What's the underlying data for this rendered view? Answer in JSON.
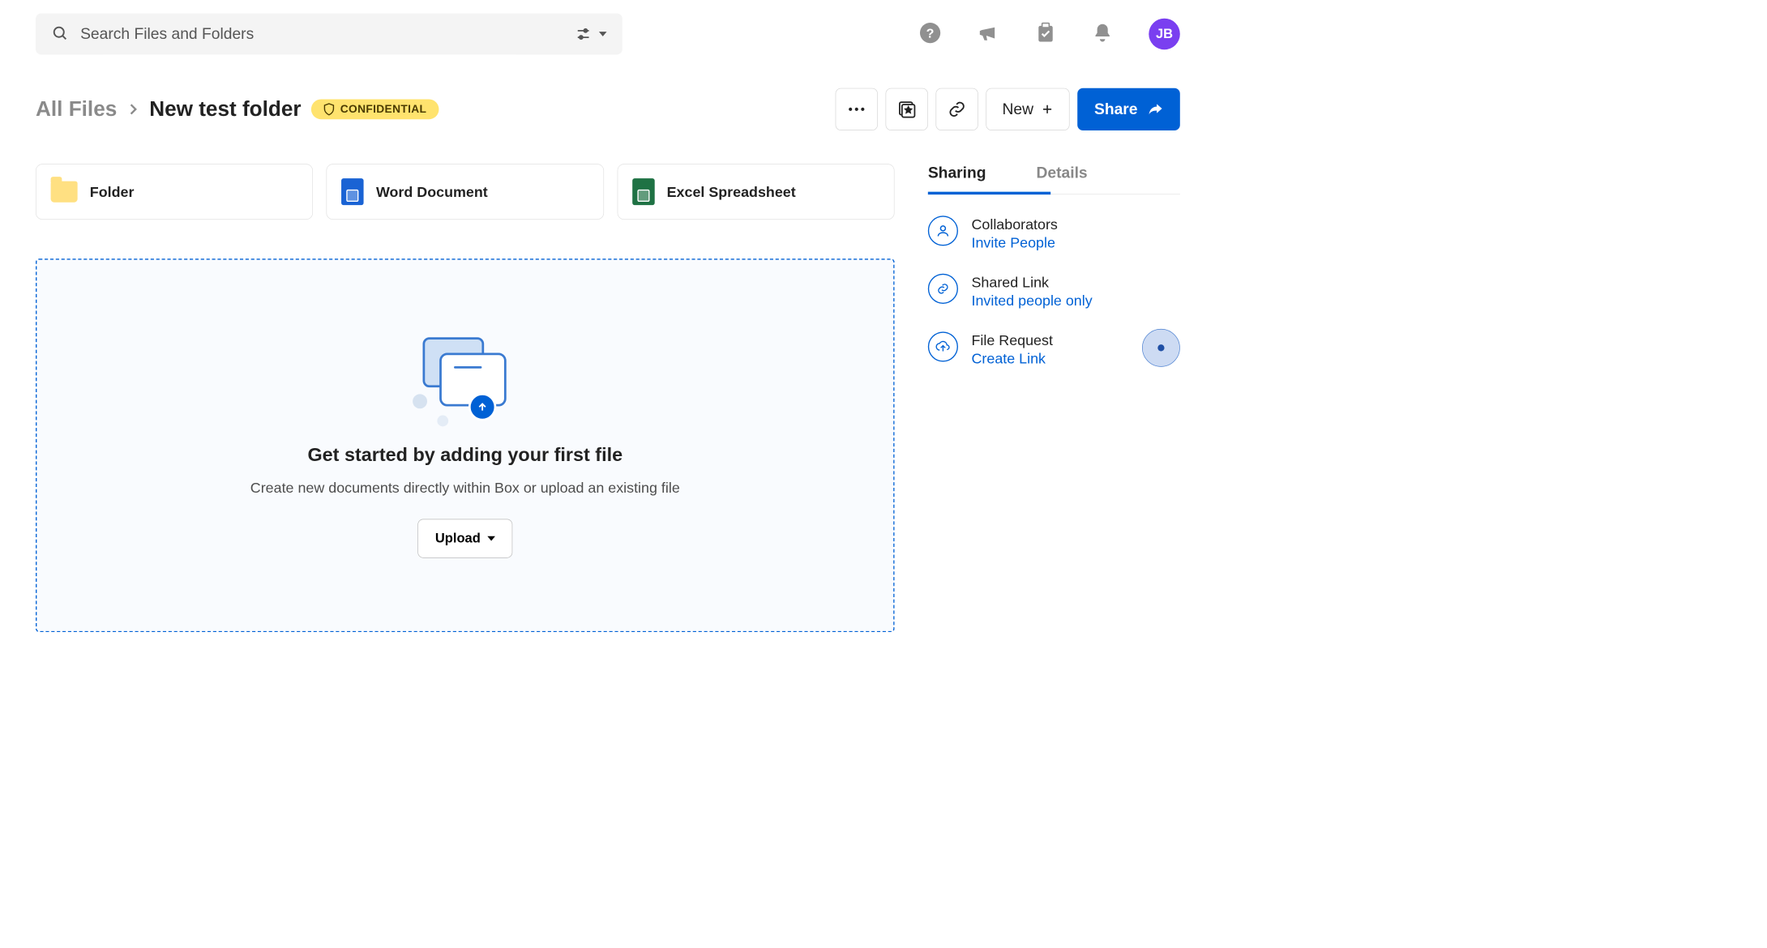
{
  "search": {
    "placeholder": "Search Files and Folders"
  },
  "avatar": {
    "initials": "JB"
  },
  "breadcrumb": {
    "root": "All Files",
    "current": "New test folder"
  },
  "classification_badge": "CONFIDENTIAL",
  "header_actions": {
    "new": "New",
    "share": "Share"
  },
  "cards": [
    {
      "label": "Folder"
    },
    {
      "label": "Word Document"
    },
    {
      "label": "Excel Spreadsheet"
    }
  ],
  "dropzone": {
    "title": "Get started by adding your first file",
    "subtitle": "Create new documents directly within Box or upload an existing file",
    "upload_label": "Upload"
  },
  "side_tabs": {
    "sharing": "Sharing",
    "details": "Details",
    "active": "sharing"
  },
  "sharing_panel": {
    "collaborators_title": "Collaborators",
    "collaborators_link": "Invite People",
    "shared_link_title": "Shared Link",
    "shared_link_text": "Invited people only",
    "file_request_title": "File Request",
    "file_request_link": "Create Link"
  }
}
